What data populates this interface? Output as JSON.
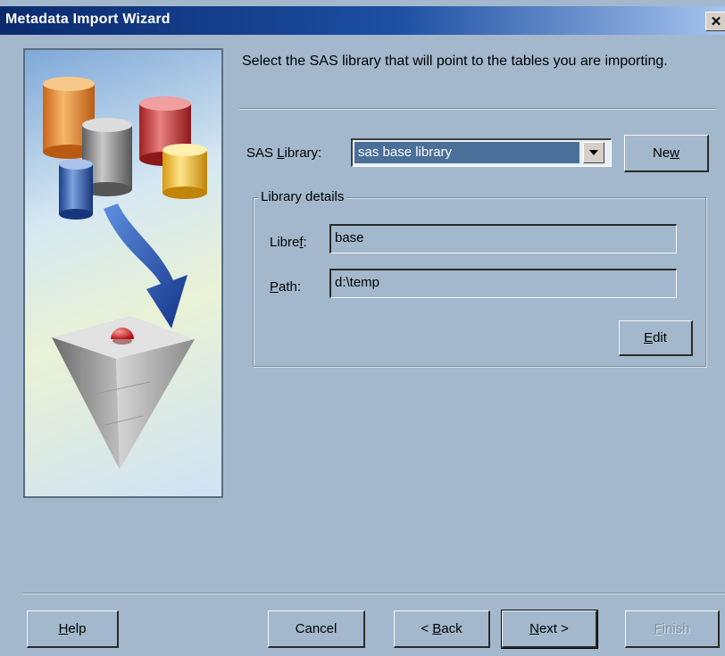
{
  "window": {
    "title": "Metadata Import Wizard",
    "close_label": "✕"
  },
  "instruction": "Select the SAS library that will point to the tables you are importing.",
  "library": {
    "label_before": "SAS ",
    "label_mnemonic": "L",
    "label_after": "ibrary:",
    "value": "sas base library",
    "new_before": "Ne",
    "new_mnemonic": "w",
    "new_after": ""
  },
  "details": {
    "legend": "Library details",
    "libref_before": "Libre",
    "libref_mnemonic": "f",
    "libref_after": ":",
    "libref_value": "base",
    "path_before": "",
    "path_mnemonic": "P",
    "path_after": "ath:",
    "path_value": "d:\\temp",
    "edit_before": "",
    "edit_mnemonic": "E",
    "edit_after": "dit"
  },
  "footer": {
    "help_before": "",
    "help_mnemonic": "H",
    "help_after": "elp",
    "cancel": "Cancel",
    "back_before": "< ",
    "back_mnemonic": "B",
    "back_after": "ack",
    "next_before": "",
    "next_mnemonic": "N",
    "next_after": "ext >",
    "finish_before": "",
    "finish_mnemonic": "F",
    "finish_after": "inish"
  }
}
